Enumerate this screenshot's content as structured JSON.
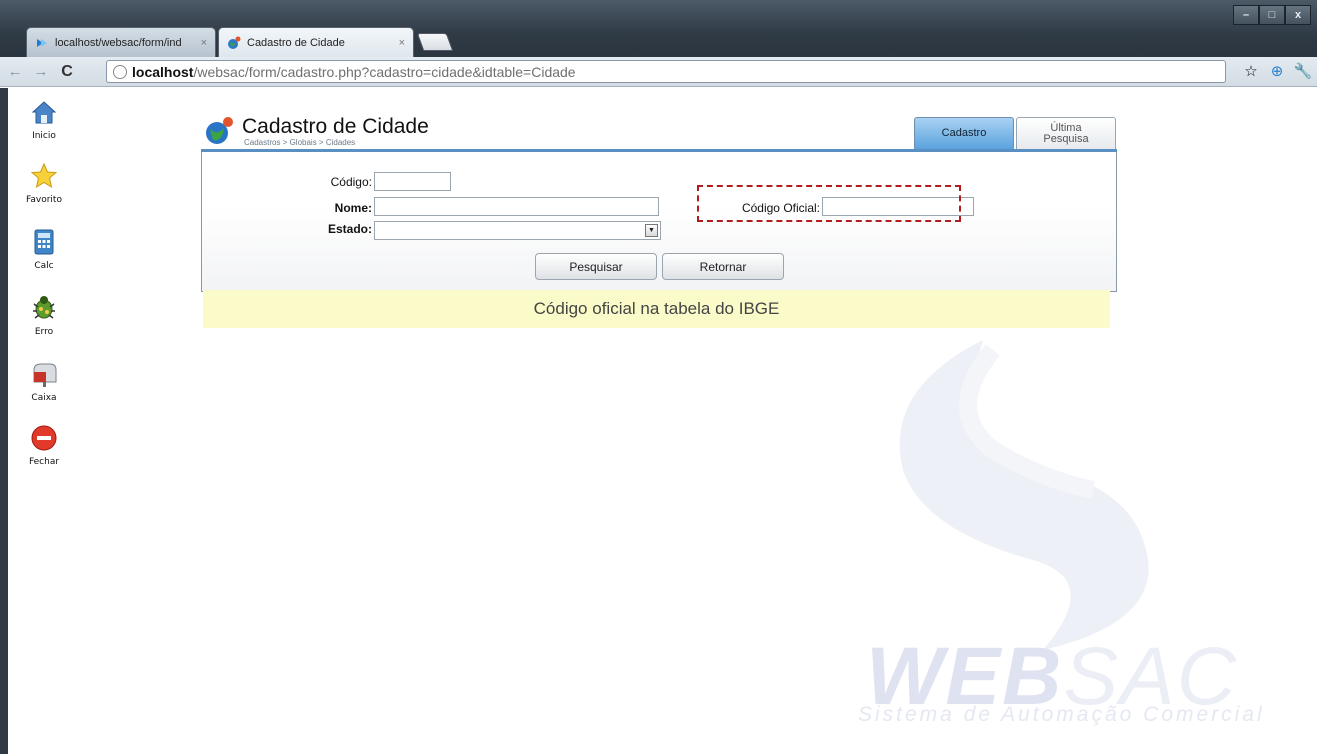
{
  "browser": {
    "tabs": [
      {
        "label": "localhost/websac/form/ind",
        "close": "×"
      },
      {
        "label": "Cadastro de Cidade",
        "close": "×"
      }
    ],
    "url_host": "localhost",
    "url_path": "/websac/form/cadastro.php?cadastro=cidade&idtable=Cidade",
    "nav": {
      "back": "←",
      "forward": "→",
      "reload": "C"
    },
    "window_controls": {
      "minimize": "–",
      "maximize": "□",
      "close": "x"
    }
  },
  "sidebar": {
    "items": [
      {
        "label": "Inicio",
        "icon": "house-icon"
      },
      {
        "label": "Favorito",
        "icon": "star-icon"
      },
      {
        "label": "Calc",
        "icon": "calculator-icon"
      },
      {
        "label": "Erro",
        "icon": "bug-icon"
      },
      {
        "label": "Caixa",
        "icon": "mailbox-icon"
      },
      {
        "label": "Fechar",
        "icon": "stop-icon"
      }
    ]
  },
  "header": {
    "title": "Cadastro de Cidade",
    "breadcrumb": "Cadastros > Globais > Cidades"
  },
  "tabs": {
    "cadastro": "Cadastro",
    "ultima_line1": "Última",
    "ultima_line2": "Pesquisa"
  },
  "form": {
    "codigo_label": "Código:",
    "nome_label": "Nome:",
    "estado_label": "Estado:",
    "codigo_oficial_label": "Código Oficial:",
    "codigo_value": "",
    "nome_value": "",
    "estado_value": "",
    "codigo_oficial_value": "",
    "pesquisar": "Pesquisar",
    "retornar": "Retornar"
  },
  "hint": "Código oficial na tabela do IBGE",
  "watermark": {
    "web": "WEB",
    "sac": "SAC",
    "subtitle": "Sistema de Automação Comercial"
  },
  "colors": {
    "accent": "#5aa2dd",
    "hint_bg": "#fbfbc9",
    "dash": "#b31c1c"
  }
}
